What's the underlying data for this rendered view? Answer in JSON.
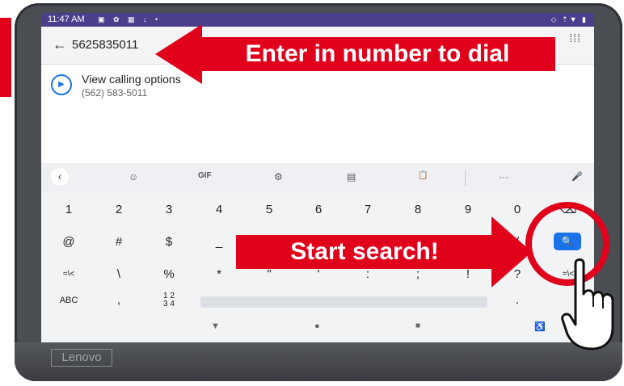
{
  "status_bar": {
    "time": "11:47 AM",
    "left_icons": "▣ ✿ ▦ ↓ •",
    "right_icons": "◇ ⇡▼ ▮"
  },
  "search_bar": {
    "number": "5625835011",
    "back_icon": "arrow-left-icon",
    "dialpad_icon": "dialpad-icon"
  },
  "calling_option": {
    "title": "View calling options",
    "subtitle": "(562) 583-5011"
  },
  "keyboard_toolbar": [
    "‹",
    "☺",
    "GIF",
    "⚙",
    "▤",
    "📋",
    "···",
    "🎤"
  ],
  "keyboard": {
    "row1": [
      "1",
      "2",
      "3",
      "4",
      "5",
      "6",
      "7",
      "8",
      "9",
      "0",
      "⌫"
    ],
    "row2": [
      "@",
      "#",
      "$",
      "_",
      "&",
      "-",
      "+",
      "(",
      ")",
      "/"
    ],
    "row3": [
      "=\\<",
      "\\",
      "%",
      "*",
      "\"",
      "'",
      ":",
      ";",
      "!",
      "?",
      "=\\<"
    ],
    "row4": [
      "ABC",
      ",",
      "1 2\n3 4",
      ".",
      ""
    ]
  },
  "nav_bar": {
    "back": "▼",
    "home": "●",
    "recents": "■",
    "accessibility": "♿"
  },
  "annotations": {
    "top_label": "Enter in number to dial",
    "bottom_label": "Start search!"
  },
  "device": {
    "brand": "Lenovo"
  },
  "colors": {
    "annotation_red": "#e0001b",
    "accent_blue": "#1a73e8",
    "status_bar": "#4b3f8c"
  }
}
